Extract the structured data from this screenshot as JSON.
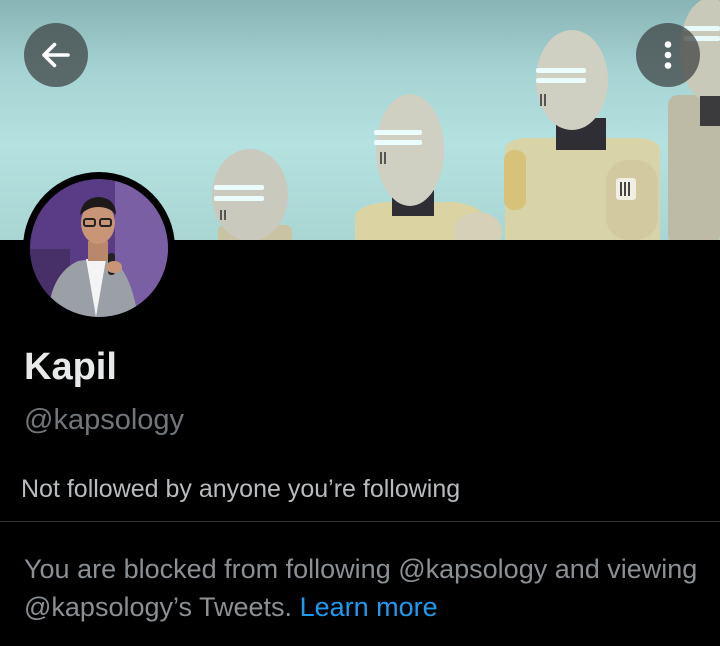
{
  "profile": {
    "name": "Kapil",
    "handle": "@kapsology",
    "followers_note": "Not followed by anyone you’re following"
  },
  "notice": {
    "blocked_text": "You are blocked from following @kapsology and viewing @kapsology’s Tweets.",
    "learn_more": "Learn more"
  },
  "icons": {
    "back": "arrow-left-icon",
    "more": "more-vertical-icon"
  },
  "colors": {
    "background": "#000000",
    "link": "#1d9bf0",
    "secondary_text": "#71767b"
  }
}
